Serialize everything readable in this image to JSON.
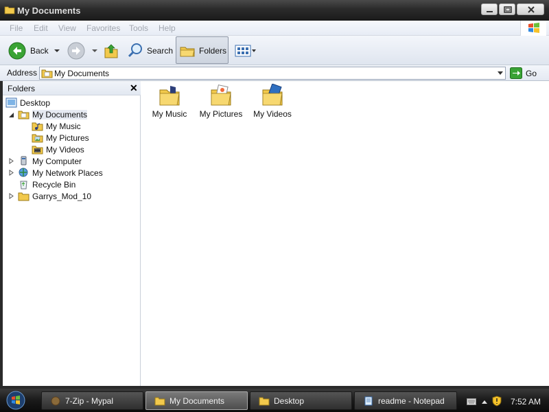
{
  "window": {
    "title": "My Documents"
  },
  "menu": [
    "File",
    "Edit",
    "View",
    "Favorites",
    "Tools",
    "Help"
  ],
  "toolbar": {
    "back_label": "Back",
    "search_label": "Search",
    "folders_label": "Folders"
  },
  "address": {
    "label": "Address",
    "value": "My Documents",
    "go_label": "Go"
  },
  "folders_pane": {
    "title": "Folders",
    "tree": [
      {
        "label": "Desktop"
      },
      {
        "label": "My Documents"
      },
      {
        "label": "My Music"
      },
      {
        "label": "My Pictures"
      },
      {
        "label": "My Videos"
      },
      {
        "label": "My Computer"
      },
      {
        "label": "My Network Places"
      },
      {
        "label": "Recycle Bin"
      },
      {
        "label": "Garrys_Mod_10"
      }
    ]
  },
  "content": {
    "items": [
      {
        "label": "My Music"
      },
      {
        "label": "My Pictures"
      },
      {
        "label": "My Videos"
      }
    ]
  },
  "taskbar": {
    "tasks": [
      {
        "label": "7-Zip - Mypal"
      },
      {
        "label": "My Documents"
      },
      {
        "label": "Desktop"
      },
      {
        "label": "readme - Notepad"
      }
    ],
    "clock": "7:52 AM"
  },
  "colors": {
    "titlebar": "#2b2b2b",
    "toolbar": "#e7ecf5",
    "selection": "#e6eaf2",
    "folder": "#f2c94c"
  }
}
